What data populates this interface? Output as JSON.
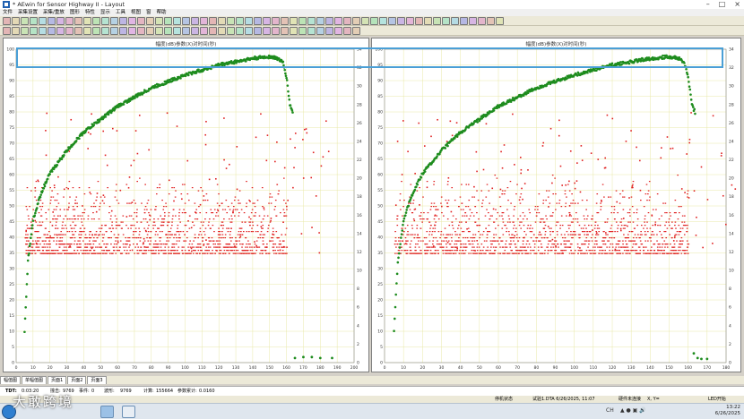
{
  "window": {
    "title": "* AEwin for Sensor Highway II - Layout"
  },
  "menu": [
    "文件",
    "采集设置",
    "采集/重放",
    "图形",
    "特性",
    "显示",
    "工具",
    "视图",
    "窗",
    "帮助"
  ],
  "panels": [
    {
      "title": "幅度(dB)参数(X)对时间(秒)",
      "xmax": 200,
      "xticks": [
        0,
        10,
        20,
        30,
        40,
        50,
        60,
        70,
        80,
        90,
        100,
        110,
        120,
        130,
        140,
        150,
        160,
        170,
        180,
        190,
        200
      ]
    },
    {
      "title": "幅度(dB)参数(X)对时间(秒)",
      "xmax": 180,
      "xticks": [
        0,
        10,
        20,
        30,
        40,
        50,
        60,
        70,
        80,
        90,
        100,
        110,
        120,
        130,
        140,
        150,
        160,
        170,
        180
      ]
    }
  ],
  "axes": {
    "left_ticks": [
      0,
      5,
      10,
      15,
      20,
      25,
      30,
      35,
      40,
      45,
      50,
      55,
      60,
      65,
      70,
      75,
      80,
      85,
      90,
      95,
      100
    ],
    "right_ticks": [
      0,
      2,
      4,
      6,
      8,
      10,
      12,
      14,
      16,
      18,
      20,
      22,
      24,
      26,
      28,
      30,
      32,
      34
    ],
    "colors": {
      "hits": "#e02020",
      "load": "#1e8c1e",
      "grid": "#e8e8a8"
    }
  },
  "chart_data": [
    {
      "type": "scatter",
      "title": "幅度(dB)参数(X)对时间(秒)",
      "xlim": [
        0,
        200
      ],
      "ylim": [
        0,
        100
      ],
      "y2lim": [
        0,
        34
      ],
      "series": [
        {
          "axis": "y2",
          "description": "green curve",
          "points": [
            [
              5,
              3.5
            ],
            [
              7,
              11
            ],
            [
              10,
              15.5
            ],
            [
              15,
              18.5
            ],
            [
              20,
              20.5
            ],
            [
              30,
              23
            ],
            [
              40,
              25
            ],
            [
              60,
              27.8
            ],
            [
              80,
              29.8
            ],
            [
              100,
              31.2
            ],
            [
              120,
              32.3
            ],
            [
              140,
              33
            ],
            [
              150,
              33.2
            ],
            [
              155,
              33
            ],
            [
              158,
              32.5
            ],
            [
              160,
              31
            ],
            [
              162,
              28
            ],
            [
              164,
              27
            ]
          ]
        },
        {
          "axis": "y2",
          "description": "post-failure",
          "points": [
            [
              165,
              0.5
            ],
            [
              170,
              0.6
            ],
            [
              175,
              0.6
            ],
            [
              180,
              0.5
            ],
            [
              187,
              0.5
            ]
          ]
        },
        {
          "axis": "y",
          "description": "red band",
          "x_range": [
            5,
            160
          ],
          "y_range": [
            35,
            60
          ]
        }
      ]
    },
    {
      "type": "scatter",
      "title": "幅度(dB)参数(X)对时间(秒)",
      "xlim": [
        0,
        180
      ],
      "ylim": [
        0,
        100
      ],
      "y2lim": [
        0,
        34
      ],
      "series": [
        {
          "axis": "y2",
          "description": "green curve",
          "points": [
            [
              5,
              3.5
            ],
            [
              7,
              11
            ],
            [
              10,
              15.5
            ],
            [
              15,
              18.5
            ],
            [
              20,
              20.5
            ],
            [
              30,
              23
            ],
            [
              40,
              25
            ],
            [
              60,
              27.8
            ],
            [
              80,
              29.8
            ],
            [
              100,
              31.2
            ],
            [
              120,
              32.3
            ],
            [
              140,
              33
            ],
            [
              150,
              33.2
            ],
            [
              155,
              33
            ],
            [
              158,
              32.5
            ],
            [
              160,
              31
            ],
            [
              162,
              28
            ],
            [
              164,
              27
            ]
          ]
        },
        {
          "axis": "y2",
          "description": "post-failure",
          "points": [
            [
              163,
              1
            ],
            [
              165,
              0.5
            ],
            [
              167,
              0.4
            ],
            [
              170,
              0.4
            ]
          ]
        },
        {
          "axis": "y",
          "description": "red band",
          "x_range": [
            5,
            160
          ],
          "y_range": [
            35,
            60
          ]
        }
      ]
    }
  ],
  "tabs": [
    "幅值图",
    "单幅值图",
    "页面1",
    "页面2",
    "页面3"
  ],
  "info": {
    "tdt_label": "TDT:",
    "tdt_value": "0:03:20",
    "hits_label": "撞击:",
    "hits_value": "9769",
    "events_label": "事件:",
    "events_value": "0",
    "waveforms_label": "波形:",
    "waveforms_value": "9769",
    "filtered_label": "计算:",
    "filtered_value": "155664",
    "extra_label": "参数累计:",
    "extra_value": "0.0160"
  },
  "status": {
    "mode": "停机状态",
    "file": "试验1.DTA  6/26/2025, 11:07",
    "hardware": "硬件未连接",
    "coords": "X, Y=",
    "led": "LED开始"
  },
  "taskbar": {
    "time": "13:22",
    "date": "6/26/2025",
    "lang": "CH"
  },
  "watermark": "大敢跨境"
}
